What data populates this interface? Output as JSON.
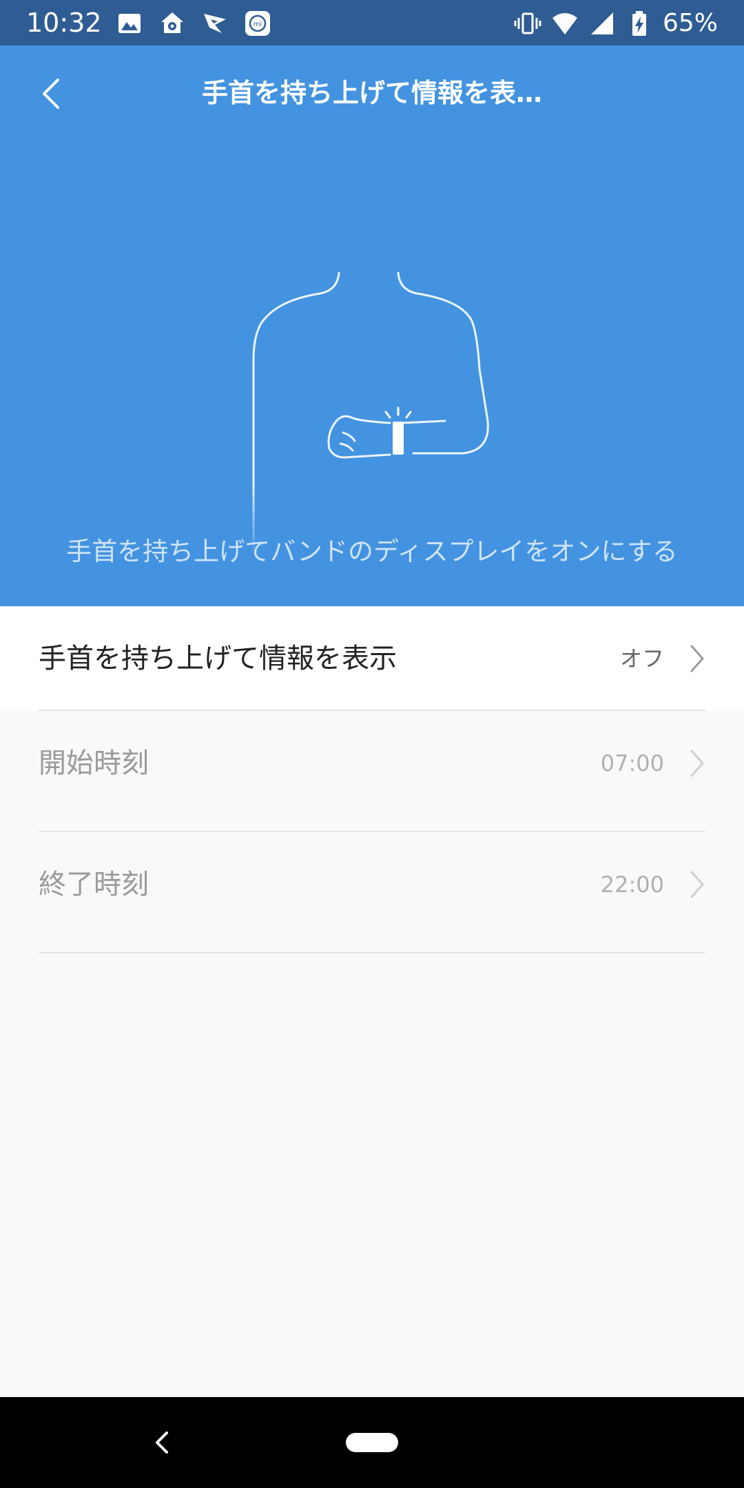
{
  "status_bar": {
    "time": "10:32",
    "left_icons": [
      "image-icon",
      "home-shield-icon",
      "vpn-icon",
      "mi-fit-icon"
    ],
    "right_icons": [
      "vibrate-icon",
      "wifi-icon",
      "signal-icon",
      "battery-charging-icon"
    ],
    "battery": "65%"
  },
  "header": {
    "background_color": "#4393e0",
    "title": "手首を持ち上げて情報を表…",
    "caption": "手首を持ち上げてバンドのディスプレイをオンにする"
  },
  "settings": [
    {
      "label": "手首を持ち上げて情報を表示",
      "value": "オフ",
      "enabled": true
    },
    {
      "label": "開始時刻",
      "value": "07:00",
      "enabled": false
    },
    {
      "label": "終了時刻",
      "value": "22:00",
      "enabled": false
    }
  ],
  "colors": {
    "status_bar": "#2f5c93",
    "active_label": "#222222",
    "disabled_label": "#9a9a9a"
  }
}
